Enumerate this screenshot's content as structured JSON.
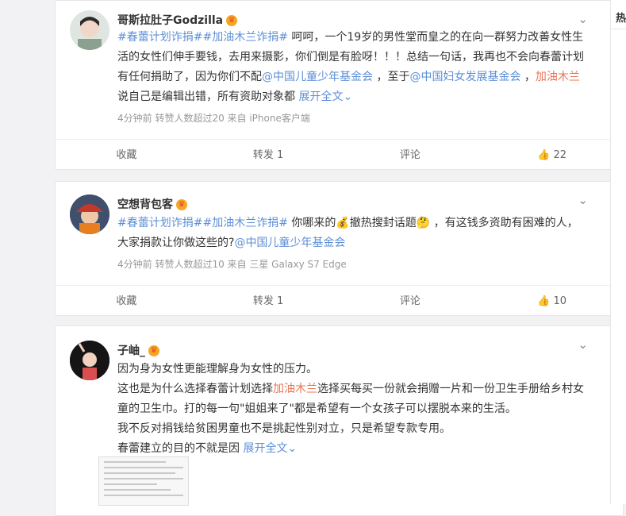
{
  "sidebar": {
    "title_char": "热"
  },
  "posts": [
    {
      "author": "哥斯拉肚子Godzilla",
      "text": [
        {
          "t": "#春蕾计划诈捐##加油木兰诈捐#",
          "c": "blue"
        },
        {
          "t": " 呵呵，一个19岁的男性堂而皇之的在向一群努力改善女性生活的女性们伸手要钱，去用来摄影，你们倒是有脸呀！！！总结一句话，我再也不会向春蕾计划有任何捐助了，因为你们不配",
          "c": ""
        },
        {
          "t": "@中国儿童少年基金会",
          "c": "blue"
        },
        {
          "t": " ，至于",
          "c": ""
        },
        {
          "t": "@中国妇女发展基金会",
          "c": "blue"
        },
        {
          "t": " ，",
          "c": ""
        },
        {
          "t": "加油木兰",
          "c": "link"
        },
        {
          "t": " 说自己是编辑出错，所有资助对象都 ",
          "c": ""
        },
        {
          "t": "展开全文⌄",
          "c": "blue"
        }
      ],
      "meta": "4分钟前 转赞人数超过20 来自 iPhone客户端",
      "actions": [
        "收藏",
        "转发 1",
        "评论",
        "👍 22"
      ]
    },
    {
      "author": "空想背包客",
      "text": [
        {
          "t": "#春蕾计划诈捐##加油木兰诈捐#",
          "c": "blue"
        },
        {
          "t": " 你哪来的💰撤热搜封话题🤔 ，有这钱多资助有困难的人，大家捐款让你做这些的?",
          "c": ""
        },
        {
          "t": "@中国儿童少年基金会",
          "c": "blue"
        }
      ],
      "meta": "4分钟前 转赞人数超过10 来自 三星 Galaxy S7 Edge",
      "actions": [
        "收藏",
        "转发 1",
        "评论",
        "👍 10"
      ]
    },
    {
      "author": "子岫_",
      "lines": [
        [
          {
            "t": "因为身为女性更能理解身为女性的压力。",
            "c": ""
          }
        ],
        [
          {
            "t": "这也是为什么选择春蕾计划选择",
            "c": ""
          },
          {
            "t": "加油木兰",
            "c": "link"
          },
          {
            "t": "选择买每买一份就会捐赠一片和一份卫生手册给乡村女童的卫生巾。打的每一句\"姐姐来了\"都是希望有一个女孩子可以摆脱本来的生活。",
            "c": ""
          }
        ],
        [
          {
            "t": "我不反对捐钱给贫困男童也不是挑起性别对立，只是希望专款专用。",
            "c": ""
          }
        ],
        [
          {
            "t": "春蕾建立的目的不就是因 ",
            "c": ""
          },
          {
            "t": "展开全文⌄",
            "c": "blue"
          }
        ]
      ]
    }
  ]
}
